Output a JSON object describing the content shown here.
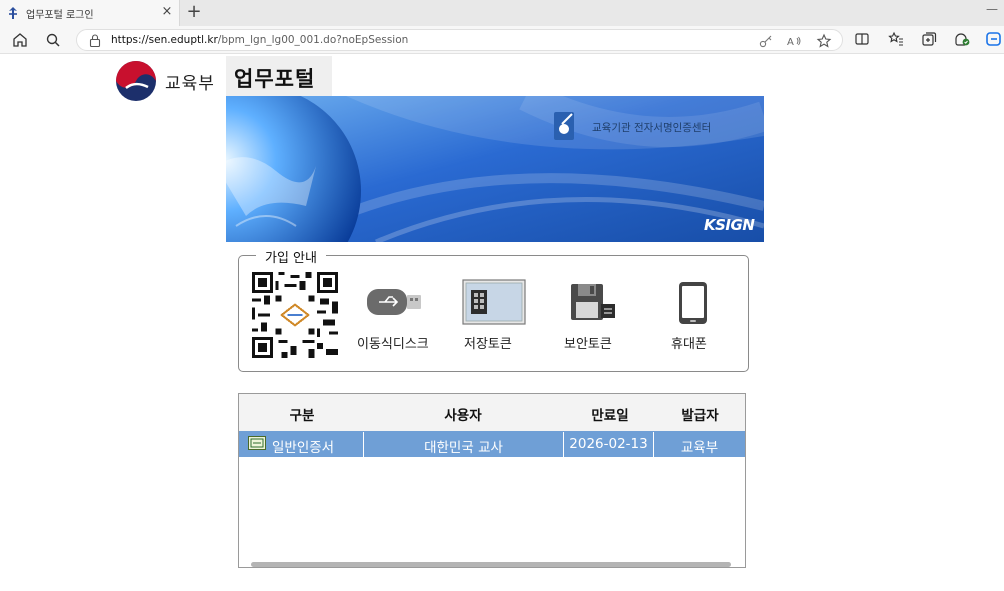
{
  "browser": {
    "tab_title": "업무포털 로그인",
    "tab_close": "×",
    "new_tab": "+",
    "minimize": "—",
    "url_host": "https://sen.eduptl.kr",
    "url_path": "/bpm_lgn_lg00_001.do?noEpSession"
  },
  "header": {
    "ministry": "교육부",
    "portal_title": "업무포털"
  },
  "banner": {
    "center_label": "교육기관 전자서명인증센터",
    "brand": "KSIGN"
  },
  "join_guide": {
    "title": "가입 안내",
    "devices": [
      {
        "label": "이동식디스크",
        "icon": "usb-drive-icon"
      },
      {
        "label": "저장토큰",
        "icon": "storage-token-icon"
      },
      {
        "label": "보안토큰",
        "icon": "security-token-icon"
      },
      {
        "label": "휴대폰",
        "icon": "mobile-phone-icon"
      }
    ]
  },
  "certificates": {
    "columns": [
      "구분",
      "사용자",
      "만료일",
      "발급자"
    ],
    "rows": [
      {
        "type": "일반인증서",
        "user": "대한민국 교사",
        "expiry": "2026-02-13",
        "issuer": "교육부"
      }
    ]
  },
  "colors": {
    "selected_row": "#6f9fd6",
    "banner_blue": "#1f5fb8"
  }
}
